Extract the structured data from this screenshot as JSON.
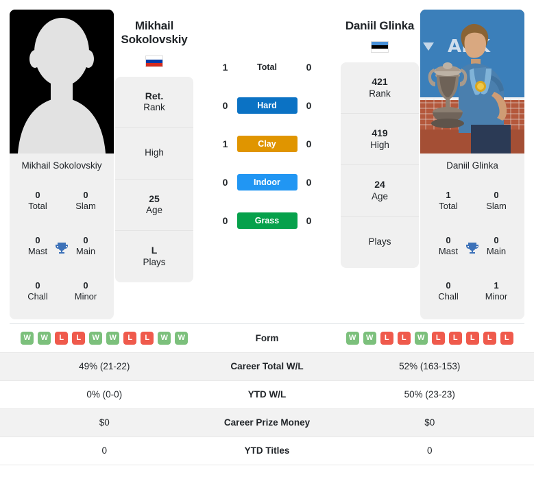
{
  "players": {
    "left": {
      "name": "Mikhail Sokolovskiy",
      "name_line1": "Mikhail",
      "name_line2": "Sokolovskiy",
      "photo_caption": "Mikhail Sokolovskiy",
      "photo_type": "placeholder-silhouette",
      "flag": {
        "country": "Russia",
        "stripes": [
          "#ffffff",
          "#0039a6",
          "#d52b1e"
        ]
      },
      "info": [
        {
          "value": "Ret.",
          "label": "Rank"
        },
        {
          "value": "",
          "label": "High"
        },
        {
          "value": "25",
          "label": "Age"
        },
        {
          "value": "L",
          "label": "Plays"
        }
      ],
      "titles": [
        {
          "value": "0",
          "label": "Total"
        },
        {
          "value": "0",
          "label": "Slam"
        },
        {
          "value": "0",
          "label": "Mast"
        },
        {
          "value": "0",
          "label": "Main"
        },
        {
          "value": "0",
          "label": "Chall"
        },
        {
          "value": "0",
          "label": "Minor"
        }
      ],
      "form": [
        "W",
        "W",
        "L",
        "L",
        "W",
        "W",
        "L",
        "L",
        "W",
        "W"
      ],
      "career_total_wl": "49% (21-22)",
      "ytd_wl": "0% (0-0)",
      "career_prize_money": "$0",
      "ytd_titles": "0"
    },
    "right": {
      "name": "Daniil Glinka",
      "name_line1": "Daniil Glinka",
      "name_line2": "",
      "photo_caption": "Daniil Glinka",
      "photo_type": "player-photo-trophy",
      "flag": {
        "country": "Estonia",
        "stripes": [
          "#4891d9",
          "#000000",
          "#ffffff"
        ]
      },
      "info": [
        {
          "value": "421",
          "label": "Rank"
        },
        {
          "value": "419",
          "label": "High"
        },
        {
          "value": "24",
          "label": "Age"
        },
        {
          "value": "",
          "label": "Plays"
        }
      ],
      "titles": [
        {
          "value": "1",
          "label": "Total"
        },
        {
          "value": "0",
          "label": "Slam"
        },
        {
          "value": "0",
          "label": "Mast"
        },
        {
          "value": "0",
          "label": "Main"
        },
        {
          "value": "0",
          "label": "Chall"
        },
        {
          "value": "1",
          "label": "Minor"
        }
      ],
      "form": [
        "W",
        "W",
        "L",
        "L",
        "W",
        "L",
        "L",
        "L",
        "L",
        "L"
      ],
      "career_total_wl": "52% (163-153)",
      "ytd_wl": "50% (23-23)",
      "career_prize_money": "$0",
      "ytd_titles": "0"
    }
  },
  "h2h": [
    {
      "label": "Total",
      "left": "1",
      "right": "0",
      "badge": false,
      "color": ""
    },
    {
      "label": "Hard",
      "left": "0",
      "right": "0",
      "badge": true,
      "color": "#0b72c4"
    },
    {
      "label": "Clay",
      "left": "1",
      "right": "0",
      "badge": true,
      "color": "#e09500"
    },
    {
      "label": "Indoor",
      "left": "0",
      "right": "0",
      "badge": true,
      "color": "#2196f3"
    },
    {
      "label": "Grass",
      "left": "0",
      "right": "0",
      "badge": true,
      "color": "#06a14b"
    }
  ],
  "stats_rows": [
    {
      "label": "Form",
      "left": "",
      "right": "",
      "is_form": true
    },
    {
      "label": "Career Total W/L",
      "left": "49% (21-22)",
      "right": "52% (163-153)",
      "is_form": false
    },
    {
      "label": "YTD W/L",
      "left": "0% (0-0)",
      "right": "50% (23-23)",
      "is_form": false
    },
    {
      "label": "Career Prize Money",
      "left": "$0",
      "right": "$0",
      "is_form": false
    },
    {
      "label": "YTD Titles",
      "left": "0",
      "right": "0",
      "is_form": false
    }
  ],
  "colors": {
    "hard": "#0b72c4",
    "clay": "#e09500",
    "indoor": "#2196f3",
    "grass": "#06a14b",
    "win": "#7cc07c",
    "loss": "#ef5a4c",
    "trophy": "#3c71b8",
    "panel_bg": "#f0f0f0"
  }
}
